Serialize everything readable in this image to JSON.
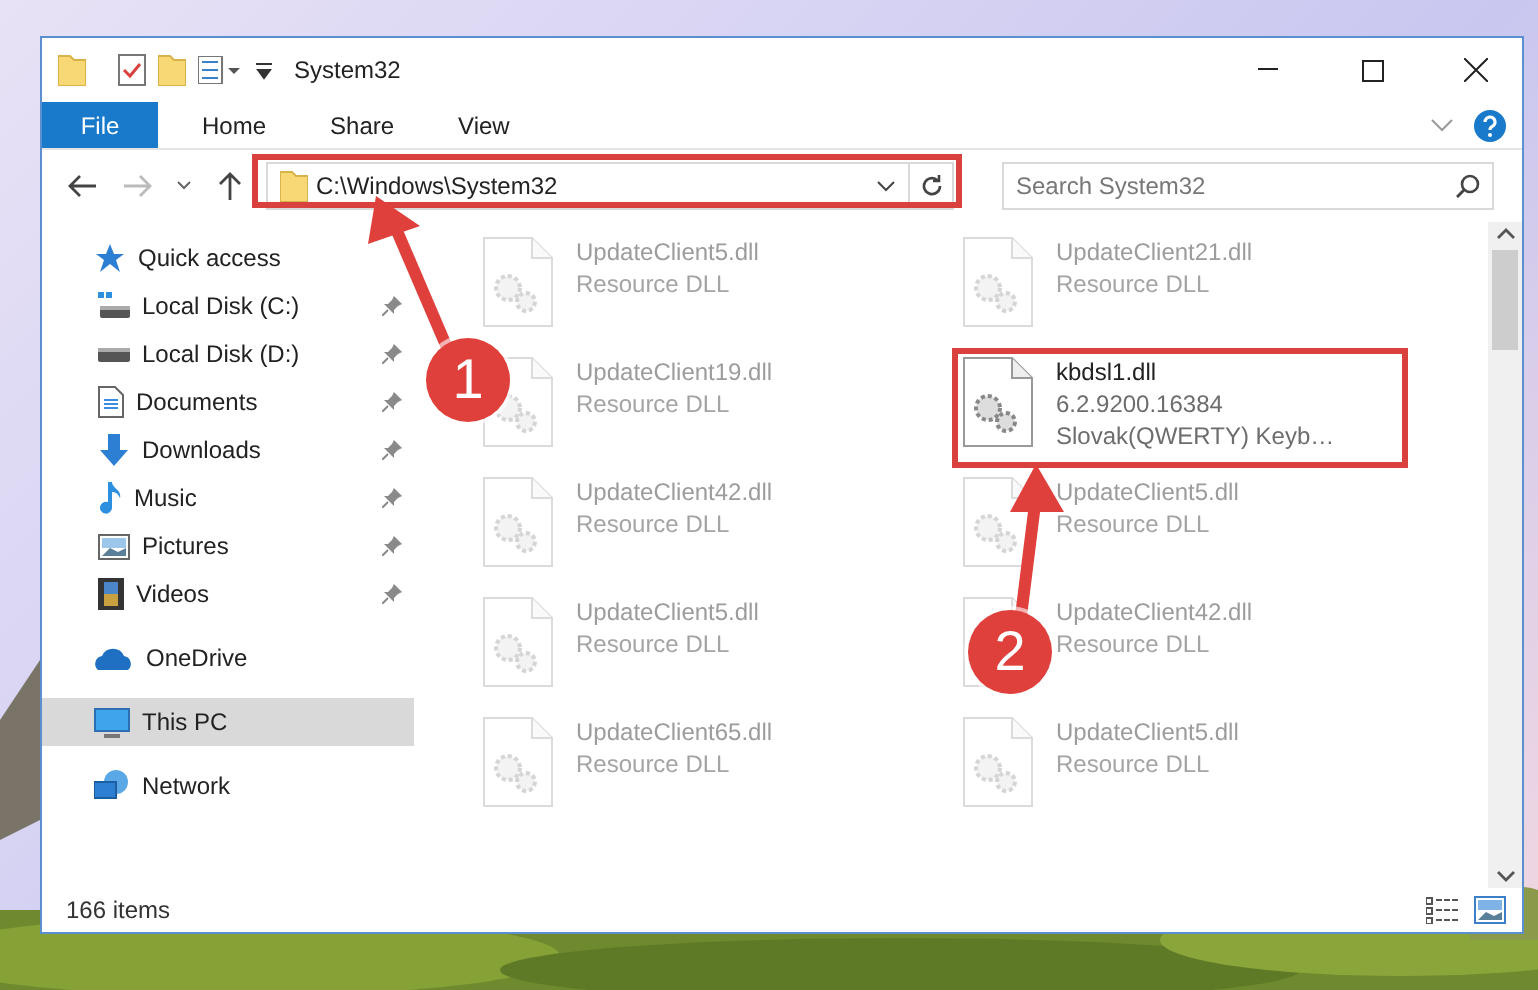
{
  "window": {
    "title": "System32"
  },
  "ribbon_tabs": [
    {
      "label": "File",
      "kind": "file"
    },
    {
      "label": "Home",
      "kind": "tab"
    },
    {
      "label": "Share",
      "kind": "tab"
    },
    {
      "label": "View",
      "kind": "tab"
    }
  ],
  "address": {
    "value": "C:\\Windows\\System32"
  },
  "search": {
    "placeholder": "Search System32"
  },
  "nav": [
    {
      "label": "Quick access",
      "kind": "star",
      "selected": false,
      "children": [
        {
          "label": "Local Disk (C:)",
          "kind": "disk-c",
          "pinned": true
        },
        {
          "label": "Local Disk (D:)",
          "kind": "disk",
          "pinned": true
        },
        {
          "label": "Documents",
          "kind": "doc",
          "pinned": true
        },
        {
          "label": "Downloads",
          "kind": "download",
          "pinned": true
        },
        {
          "label": "Music",
          "kind": "music",
          "pinned": true
        },
        {
          "label": "Pictures",
          "kind": "pictures",
          "pinned": true
        },
        {
          "label": "Videos",
          "kind": "videos",
          "pinned": true
        }
      ]
    },
    {
      "label": "OneDrive",
      "kind": "cloud",
      "selected": false
    },
    {
      "label": "This PC",
      "kind": "pc",
      "selected": true
    },
    {
      "label": "Network",
      "kind": "network",
      "selected": false
    }
  ],
  "files": [
    {
      "lines": [
        "UpdateClient5.dll",
        "Resource DLL"
      ],
      "faded": true
    },
    {
      "lines": [
        "UpdateClient21.dll",
        "Resource DLL"
      ],
      "faded": true
    },
    {
      "lines": [
        "UpdateClient19.dll",
        "Resource DLL"
      ],
      "faded": true
    },
    {
      "lines": [
        "kbdsl1.dll",
        "6.2.9200.16384",
        "Slovak(QWERTY) Keyb…"
      ],
      "faded": false
    },
    {
      "lines": [
        "UpdateClient42.dll",
        "Resource DLL"
      ],
      "faded": true
    },
    {
      "lines": [
        "UpdateClient5.dll",
        "Resource DLL"
      ],
      "faded": true
    },
    {
      "lines": [
        "UpdateClient5.dll",
        "Resource DLL"
      ],
      "faded": true
    },
    {
      "lines": [
        "UpdateClient42.dll",
        "Resource DLL"
      ],
      "faded": true
    },
    {
      "lines": [
        "UpdateClient65.dll",
        "Resource DLL"
      ],
      "faded": true
    },
    {
      "lines": [
        "UpdateClient5.dll",
        "Resource DLL"
      ],
      "faded": true
    }
  ],
  "status_bar": {
    "count": "166 items"
  },
  "annotations": [
    {
      "label": "1"
    },
    {
      "label": "2"
    }
  ]
}
